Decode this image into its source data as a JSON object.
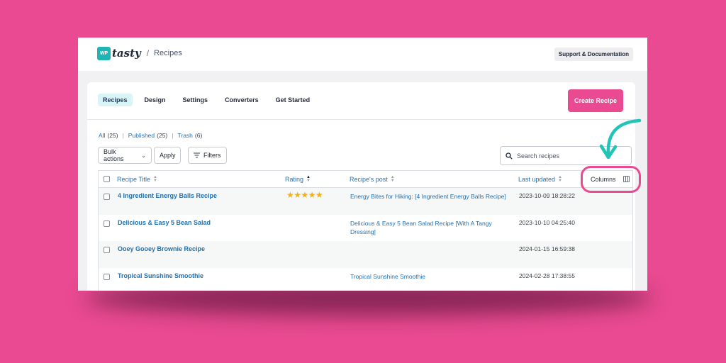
{
  "header": {
    "logo_box": "WP",
    "logo_text": "tasty",
    "breadcrumb_sep": "/",
    "breadcrumb_page": "Recipes",
    "support_label": "Support & Documentation"
  },
  "nav": {
    "tabs": [
      {
        "label": "Recipes",
        "active": true
      },
      {
        "label": "Design"
      },
      {
        "label": "Settings"
      },
      {
        "label": "Converters"
      },
      {
        "label": "Get Started"
      }
    ],
    "create_label": "Create Recipe"
  },
  "views": {
    "all": "All",
    "all_count": "(25)",
    "published": "Published",
    "published_count": "(25)",
    "trash": "Trash",
    "trash_count": "(6)"
  },
  "toolbar": {
    "bulk_label": "Bulk actions",
    "apply_label": "Apply",
    "filters_label": "Filters",
    "search_placeholder": "Search recipes"
  },
  "table": {
    "headers": {
      "title": "Recipe Title",
      "rating": "Rating",
      "post": "Recipe's post",
      "updated": "Last updated",
      "columns": "Columns"
    },
    "rows": [
      {
        "title": "4 Ingredient Energy Balls Recipe",
        "rating": 5,
        "post": "Energy Bites for Hiking: [4 Ingredient Energy Balls Recipe]",
        "updated": "2023-10-09 18:28:22"
      },
      {
        "title": "Delicious & Easy 5 Bean Salad",
        "rating": 0,
        "post": "Delicious & Easy 5 Bean Salad Recipe [With A Tangy Dressing]",
        "updated": "2023-10-10 04:25:40"
      },
      {
        "title": "Ooey Gooey Brownie Recipe",
        "rating": 0,
        "post": "",
        "updated": "2024-01-15 16:59:38"
      },
      {
        "title": "Tropical Sunshine Smoothie",
        "rating": 0,
        "post": "Tropical Sunshine Smoothie",
        "updated": "2024-02-28 17:38:55"
      }
    ]
  },
  "colors": {
    "brand_pink": "#e94a91",
    "teal": "#1fb5b5",
    "link_blue": "#2271b1",
    "star": "#f2b01e"
  }
}
